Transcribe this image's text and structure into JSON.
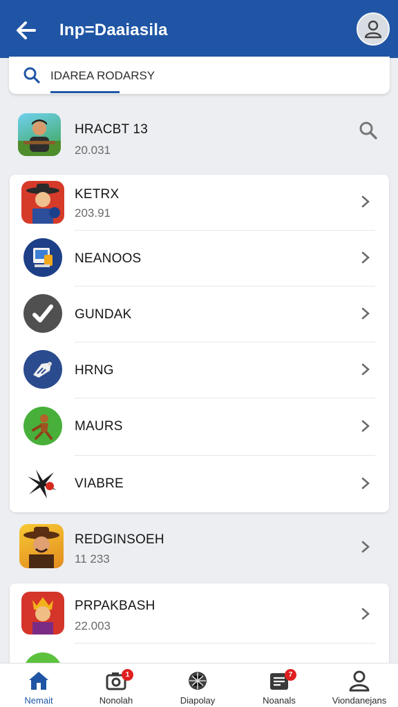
{
  "header": {
    "title": "Inp=Daaiasila",
    "back_icon": "arrow-left-icon",
    "profile_icon": "user-icon"
  },
  "search": {
    "value": "IDAREA RODARSY",
    "icon": "search-icon"
  },
  "top_item": {
    "name": "HRACBT 13",
    "sub": "20.031",
    "action_icon": "search-icon"
  },
  "card_items": [
    {
      "name": "KETRX",
      "sub": "203.91"
    },
    {
      "name": "NEANOOS",
      "sub": ""
    },
    {
      "name": "GUNDAK",
      "sub": ""
    },
    {
      "name": "HRNG",
      "sub": ""
    },
    {
      "name": "MAURS",
      "sub": ""
    },
    {
      "name": "VIABRE",
      "sub": ""
    }
  ],
  "loose_item": {
    "name": "REDGINSOEH",
    "sub": "11 233"
  },
  "card2_item": {
    "name": "PRPAKBASH",
    "sub": "22.003"
  },
  "bottom_nav": [
    {
      "label": "Nemait",
      "icon": "home-icon",
      "active": true
    },
    {
      "label": "Nonolah",
      "icon": "camera-icon",
      "badge": "1"
    },
    {
      "label": "Diapolay",
      "icon": "compass-icon"
    },
    {
      "label": "Noanals",
      "icon": "inbox-icon",
      "badge": "7"
    },
    {
      "label": "Viondanejans",
      "icon": "user-icon"
    }
  ],
  "colors": {
    "header": "#1f55a4",
    "background": "#eceef1",
    "badge": "#e02020"
  }
}
